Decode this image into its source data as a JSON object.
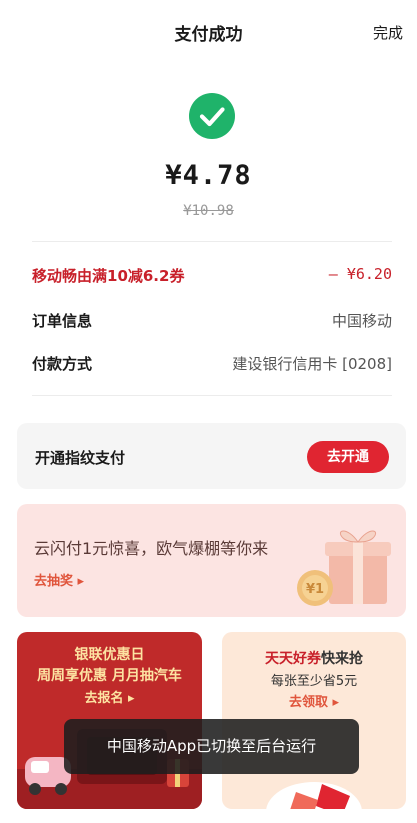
{
  "header": {
    "title": "支付成功",
    "done_label": "完成"
  },
  "payment": {
    "amount": "¥4.78",
    "original_amount": "¥10.98"
  },
  "details": {
    "coupon_label": "移动畅由满10减6.2券",
    "coupon_value": "– ¥6.20",
    "order_label": "订单信息",
    "order_value": "中国移动",
    "method_label": "付款方式",
    "method_value": "建设银行信用卡 [0208]"
  },
  "fingerprint": {
    "label": "开通指纹支付",
    "button": "去开通"
  },
  "banner": {
    "title": "云闪付1元惊喜，欧气爆棚等你来",
    "link": "去抽奖 ▸",
    "coin_text": "¥1"
  },
  "promo_left": {
    "line1": "银联优惠日",
    "line2": "周周享优惠 月月抽汽车",
    "link": "去报名 ▸"
  },
  "promo_right": {
    "line1_highlight": "天天好券",
    "line1_rest": "快来抢",
    "line2": "每张至少省5元",
    "link": "去领取 ▸"
  },
  "toast": {
    "message": "中国移动App已切换至后台运行"
  },
  "colors": {
    "accent_red": "#e02531",
    "success_green": "#1fb36a"
  }
}
